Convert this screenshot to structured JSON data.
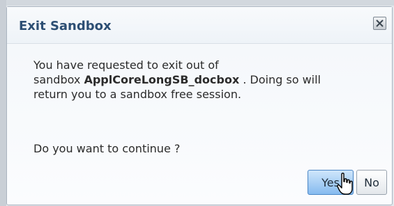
{
  "dialog": {
    "title": "Exit Sandbox",
    "close_icon": "close-icon",
    "message": {
      "line1": "You have requested to exit out of",
      "line2_prefix": "sandbox ",
      "sandbox_name": "ApplCoreLongSB_docbox",
      "line2_suffix": " . Doing so will",
      "line3": "return you to a sandbox free session."
    },
    "question": "Do you want to continue ?",
    "buttons": {
      "yes_label": "Yes",
      "no_label": "No"
    }
  },
  "colors": {
    "title": "#2c4e73",
    "yes_button": "#86bbef",
    "border": "#aab4c0"
  },
  "cursor_icon": "pointer-hand-icon"
}
